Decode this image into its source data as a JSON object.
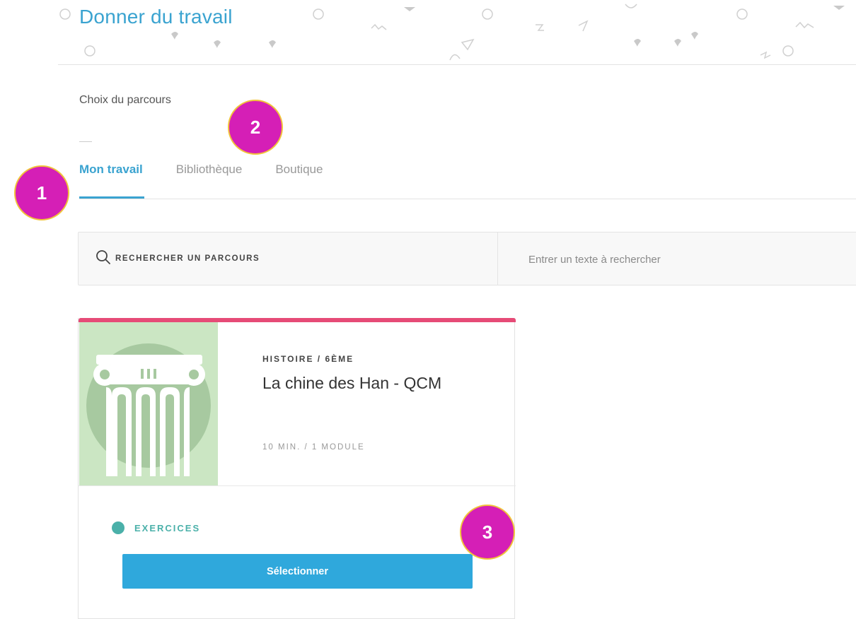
{
  "header": {
    "title": "Donner du travail"
  },
  "section": {
    "label": "Choix du parcours"
  },
  "tabs": [
    {
      "label": "Mon travail",
      "active": true
    },
    {
      "label": "Bibliothèque",
      "active": false
    },
    {
      "label": "Boutique",
      "active": false
    }
  ],
  "search": {
    "label": "RECHERCHER UN PARCOURS",
    "placeholder": "Entrer un texte à rechercher",
    "icon": "search-icon"
  },
  "card": {
    "subject": "HISTOIRE / 6ÈME",
    "title": "La chine des Han - QCM",
    "meta": "10 MIN. / 1 MODULE",
    "type_label": "EXERCICES",
    "select_label": "Sélectionner",
    "thumbnail_icon": "column-icon",
    "colors": {
      "accent_bar": "#e64b77",
      "thumb_bg": "#cbe6c3",
      "type_dot": "#4ab0a9",
      "button": "#2fa8dc"
    }
  },
  "badges": [
    "1",
    "2",
    "3"
  ],
  "colors": {
    "primary": "#3aa3d0",
    "badge": "#d51fb6",
    "badge_border": "#f1c43a"
  }
}
